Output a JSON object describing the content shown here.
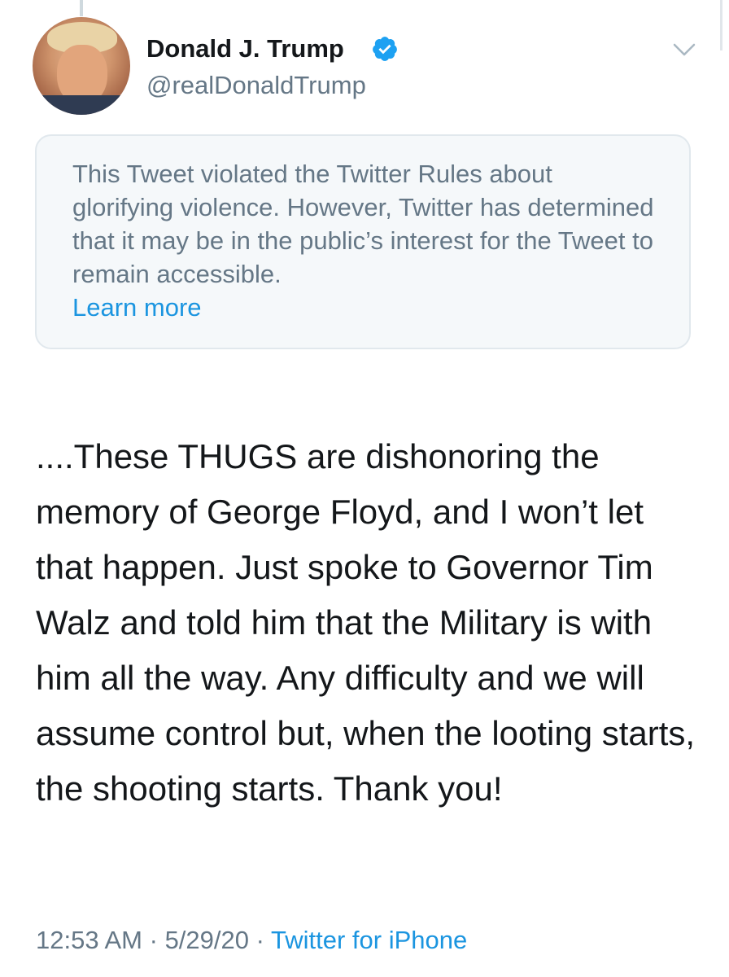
{
  "user": {
    "display_name": "Donald J. Trump",
    "handle": "@realDonaldTrump",
    "verified": true
  },
  "icons": {
    "verified": "verified-badge-icon",
    "menu": "chevron-down-icon"
  },
  "notice": {
    "text": "This Tweet violated the Twitter Rules about glorifying violence. However, Twitter has determined that it may be in the public’s interest for the Tweet to remain accessible.",
    "link_label": "Learn more"
  },
  "tweet": {
    "text": "....These THUGS are dishonoring the memory of George Floyd, and I won’t let that happen. Just spoke to Governor Tim Walz and told him that the Military is with him all the way. Any difficulty and we will assume control but, when the looting starts, the shooting starts. Thank you!"
  },
  "meta": {
    "time": "12:53 AM",
    "separator": "·",
    "date": "5/29/20",
    "source": "Twitter for iPhone"
  },
  "colors": {
    "link": "#1b95e0",
    "verified_badge": "#1da1f2",
    "secondary_text": "#657786",
    "primary_text": "#14171a",
    "notice_background": "#f5f8fa"
  }
}
